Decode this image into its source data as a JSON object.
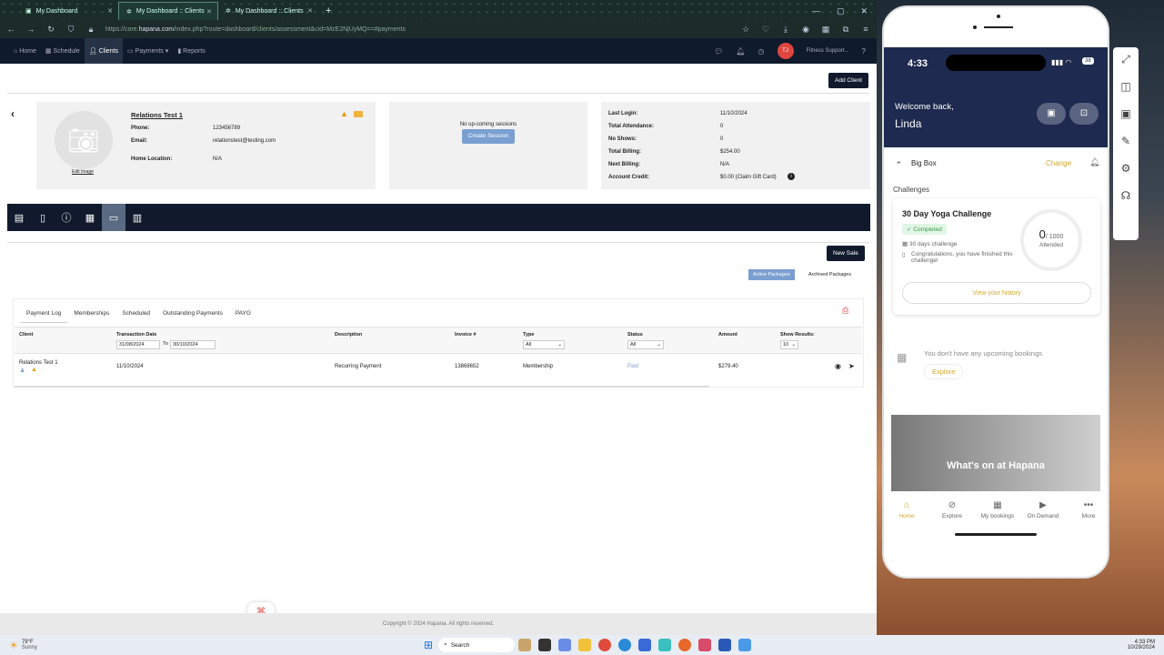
{
  "browser": {
    "tabs": [
      {
        "label": "My Dashboard"
      },
      {
        "label": "My Dashboard :: Clients"
      },
      {
        "label": "My Dashboard :: Clients"
      }
    ],
    "url_prefix": "https://core.",
    "url_domain": "hapana.com",
    "url_rest": "/index.php?route=dashboard/clients/assessment&cid=MzE2NjUyMQ==#payments"
  },
  "nav": {
    "items": [
      "Home",
      "Schedule",
      "Clients",
      "Payments",
      "Reports"
    ],
    "avatar_initials": "TJ",
    "account": "Fitness Support..."
  },
  "add_client": "Add Client",
  "client": {
    "name": "Relations Test 1",
    "phone_label": "Phone:",
    "phone": "123456789",
    "email_label": "Email:",
    "email": "relationstest@testing.com",
    "home_label": "Home Location:",
    "home": "N/A",
    "edit_image": "Edit Image"
  },
  "sessions": {
    "none": "No up-coming sessions",
    "create": "Create Session"
  },
  "stats": [
    {
      "label": "Last Login:",
      "value": "11/10/2024"
    },
    {
      "label": "Total Attendance:",
      "value": "0"
    },
    {
      "label": "No Shows:",
      "value": "0"
    },
    {
      "label": "Total Billing:",
      "value": "$254.00"
    },
    {
      "label": "Next Billing:",
      "value": "N/A"
    },
    {
      "label": "Account Credit:",
      "value": "$0.00 (Claim Gift Card)"
    }
  ],
  "new_sale": "New Sale",
  "packages": {
    "active": "Active Packages",
    "archived": "Archived Packages"
  },
  "subtabs": [
    "Payment Log",
    "Memberships",
    "Scheduled",
    "Outstanding Payments",
    "PAYG"
  ],
  "table": {
    "headers": {
      "client": "Client",
      "date": "Transaction Date",
      "desc": "Description",
      "invoice": "Invoice #",
      "type": "Type",
      "status": "Status",
      "amount": "Amount",
      "show": "Show Results:"
    },
    "filters": {
      "from": "31/08/2024",
      "to_label": "To",
      "to": "30/10/2024",
      "type": "All",
      "status": "All",
      "show": "10"
    },
    "rows": [
      {
        "client": "Relations Test 1",
        "date": "11/10/2024",
        "desc": "Recurring Payment",
        "invoice": "13868652",
        "type": "Membership",
        "status": "Paid",
        "amount": "$279.40"
      }
    ]
  },
  "footer": "Copyright © 2024 Hapana. All rights reserved.",
  "phone": {
    "time": "4:33",
    "battery": "38",
    "welcome": "Welcome back,",
    "name": "Linda",
    "location": "Big Box",
    "change": "Change",
    "challenges_title": "Challenges",
    "challenge": {
      "name": "30 Day Yoga Challenge",
      "status": "Completed",
      "duration": "30 days challenge",
      "message": "Congratulations, you have finished this challenge!",
      "count": "0",
      "total": "/ 1000",
      "attended": "Attended",
      "history": "View your history"
    },
    "no_bookings": "You don't have any upcoming bookings",
    "explore_btn": "Explore",
    "banner": "What's on at Hapana",
    "tabs": [
      "Home",
      "Explore",
      "My bookings",
      "On Demand",
      "More"
    ]
  },
  "taskbar": {
    "weather_temp": "79°F",
    "weather_desc": "Sunny",
    "search": "Search",
    "time": "4:33 PM",
    "date": "10/29/2024"
  },
  "colors": {
    "navy": "#101a2c",
    "accent": "#d4a72c",
    "phone_header": "#1e2a4f"
  }
}
